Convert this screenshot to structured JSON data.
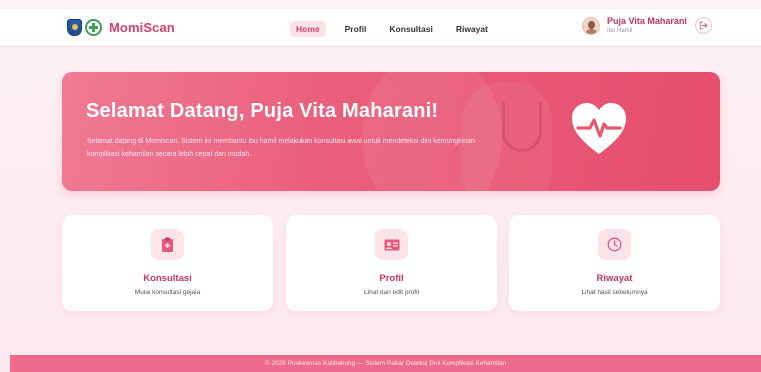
{
  "header": {
    "brand_name": "MomiScan",
    "nav": [
      {
        "label": "Home"
      },
      {
        "label": "Profil"
      },
      {
        "label": "Konsultasi"
      },
      {
        "label": "Riwayat"
      }
    ],
    "user": {
      "name": "Puja Vita Maharani",
      "role": "Ibu Hamil"
    }
  },
  "hero": {
    "title": "Selamat Datang, Puja Vita Maharani!",
    "description": "Selamat datang di Momiscan. Sistem ini membantu ibu hamil melakukan konsultasi awal untuk mendeteksi dini kemungkinan komplikasi kehamilan secara lebih cepat dan mudah."
  },
  "cards": [
    {
      "title": "Konsultasi",
      "desc": "Mulai konsultasi gejala",
      "icon": "clipboard-icon"
    },
    {
      "title": "Profil",
      "desc": "Lihat dan edit profil",
      "icon": "id-card-icon"
    },
    {
      "title": "Riwayat",
      "desc": "Lihat hasil sebelumnya",
      "icon": "clock-icon"
    }
  ],
  "footer": {
    "text": "© 2026 Puskesmas Kalibakung — Sistem Pakar Deteksi Dini Komplikasi Kehamilan"
  },
  "colors": {
    "accent": "#d9406a",
    "hero": "#ea5f7d",
    "footer": "#ee6b8c",
    "icon_bg": "#fde3ea"
  }
}
